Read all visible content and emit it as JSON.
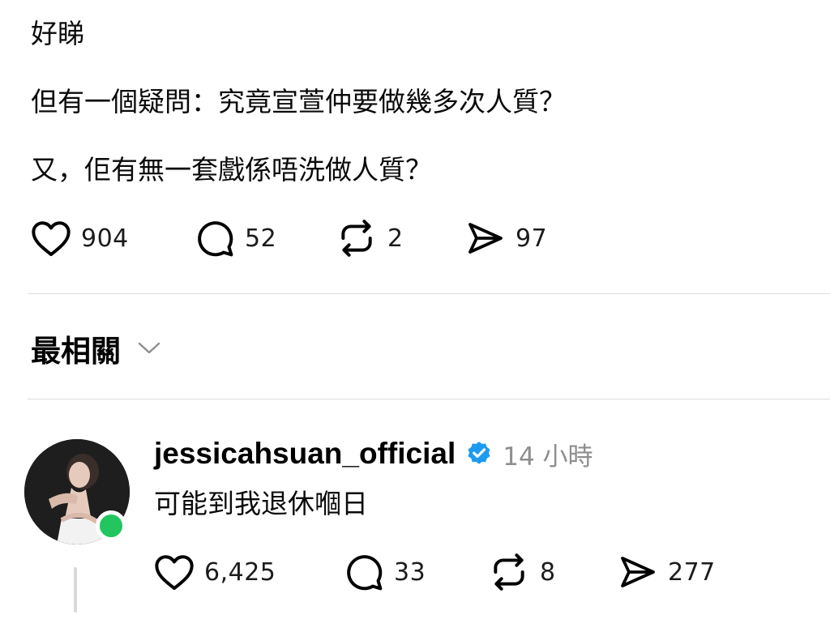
{
  "post": {
    "lines": [
      "好睇",
      "但有一個疑問：究竟宣萱仲要做幾多次人質？",
      "又，佢有無一套戲係唔洗做人質？"
    ],
    "actions": {
      "like_icon": "heart-icon",
      "like_count": "904",
      "comment_icon": "comment-bubble-icon",
      "comment_count": "52",
      "repost_icon": "repost-icon",
      "repost_count": "2",
      "share_icon": "send-icon",
      "share_count": "97"
    }
  },
  "section": {
    "title": "最相關",
    "dropdown_icon": "chevron-down-icon"
  },
  "reply": {
    "username": "jessicahsuan_official",
    "verified_icon": "verified-badge-icon",
    "timestamp": "14 小時",
    "text": "可能到我退休嗰日",
    "status_indicator": "online",
    "actions": {
      "like_count": "6,425",
      "comment_count": "33",
      "repost_count": "8",
      "share_count": "277"
    }
  },
  "colors": {
    "text": "#000000",
    "secondary_text": "#8e8e8e",
    "divider": "#dcdcdc",
    "verified_badge": "#1d9bf0",
    "online_dot": "#22c55e"
  }
}
